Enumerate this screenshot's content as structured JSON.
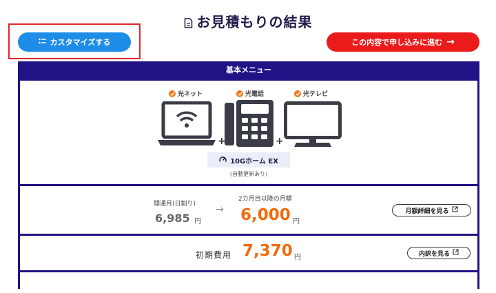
{
  "header": {
    "title": "お見積もりの結果"
  },
  "buttons": {
    "customize_label": "カスタマイズする",
    "apply_label": "この内容で申し込みに進む",
    "apply_arrow": "→"
  },
  "panel": {
    "title": "基本メニュー"
  },
  "services": [
    {
      "label": "光ネット",
      "icon": "laptop-wifi-icon"
    },
    {
      "label": "光電話",
      "icon": "telephone-icon"
    },
    {
      "label": "光テレビ",
      "icon": "tv-icon"
    }
  ],
  "plan": {
    "name": "10Gホーム EX",
    "note": "(自動更新あり)",
    "icon": "speed-gauge-icon"
  },
  "monthly": {
    "first_month_label": "開通月(日割り)",
    "first_month_price": "6,985",
    "regular_label": "2カ月目以降の月額",
    "regular_price": "6,000",
    "unit": "円",
    "details_label": "月額詳細を見る"
  },
  "initial": {
    "label": "初期費用",
    "price": "7,370",
    "unit": "円",
    "details_label": "内訳を見る"
  },
  "colors": {
    "brand_navy": "#1f1385",
    "primary_blue": "#1e8de8",
    "cta_red": "#ec1b1b",
    "price_orange": "#f26a0a",
    "check_orange": "#f07a1a"
  }
}
